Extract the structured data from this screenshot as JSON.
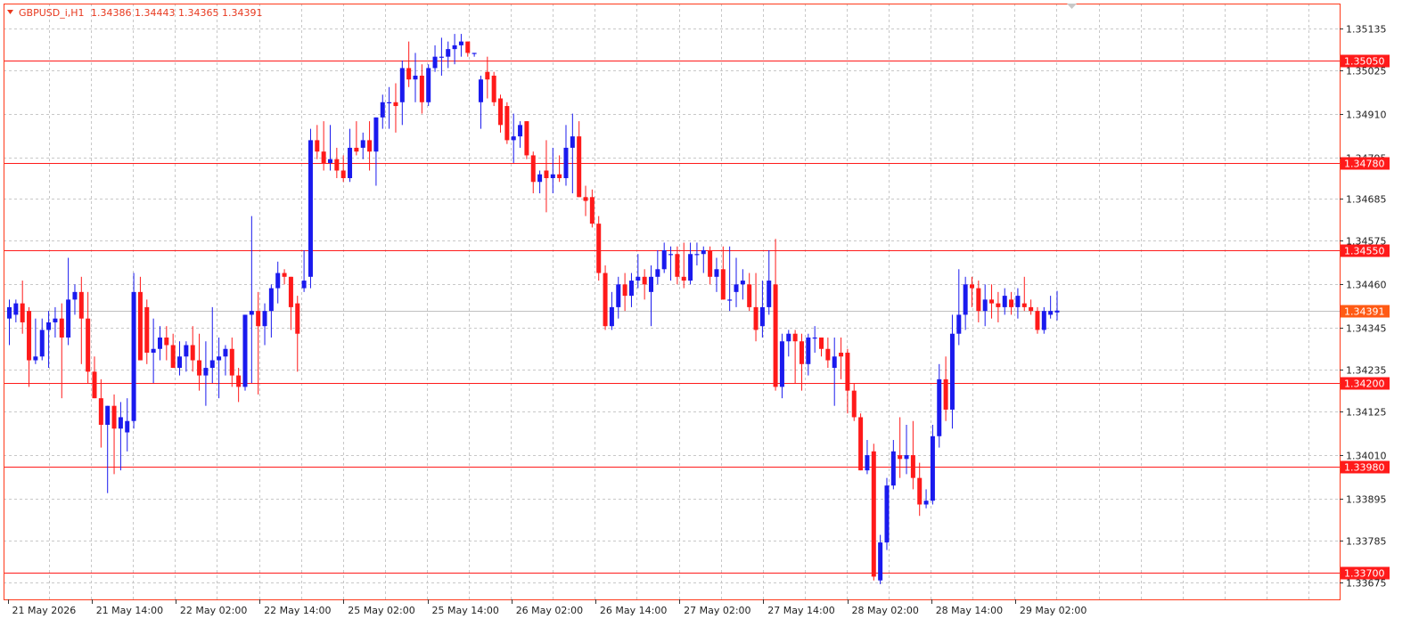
{
  "header": {
    "symbol_label": "GBPUSD_i,H1",
    "ohlc": "1.34386 1.34443 1.34365 1.34391",
    "collapse_icon": "triangle-down-icon"
  },
  "colors": {
    "bull": "#1a1aee",
    "bear": "#ff1a1a",
    "grid": "#c8c8c8",
    "level_line": "#ff1a1a",
    "frame": "#ff3a1a",
    "bid_line": "#c0c0c0",
    "bid_label_bg": "#ff5a14"
  },
  "chart_data": {
    "type": "candlestick",
    "symbol": "GBPUSD_i",
    "timeframe": "H1",
    "ylim": [
      1.3363,
      1.352
    ],
    "y_ticks": [
      "1.35135",
      "1.35025",
      "1.34910",
      "1.34795",
      "1.34685",
      "1.34575",
      "1.34460",
      "1.34345",
      "1.34235",
      "1.34125",
      "1.34010",
      "1.33895",
      "1.33785",
      "1.33675"
    ],
    "x_ticks": [
      "21 May 2026",
      "21 May 14:00",
      "22 May 02:00",
      "22 May 14:00",
      "25 May 02:00",
      "25 May 14:00",
      "26 May 02:00",
      "26 May 14:00",
      "27 May 02:00",
      "27 May 14:00",
      "28 May 02:00",
      "28 May 14:00",
      "29 May 02:00"
    ],
    "levels": [
      "1.35050",
      "1.34780",
      "1.34550",
      "1.34200",
      "1.33980",
      "1.33700"
    ],
    "current_price": "1.34391",
    "grid": true,
    "candles": [
      {
        "o": 1.3437,
        "h": 1.3442,
        "l": 1.343,
        "c": 1.344
      },
      {
        "o": 1.3438,
        "h": 1.3442,
        "l": 1.3436,
        "c": 1.3441
      },
      {
        "o": 1.3441,
        "h": 1.3447,
        "l": 1.3433,
        "c": 1.3436
      },
      {
        "o": 1.3439,
        "h": 1.344,
        "l": 1.3419,
        "c": 1.3426
      },
      {
        "o": 1.3426,
        "h": 1.3437,
        "l": 1.3425,
        "c": 1.3427
      },
      {
        "o": 1.3427,
        "h": 1.3437,
        "l": 1.3426,
        "c": 1.3434
      },
      {
        "o": 1.3434,
        "h": 1.3439,
        "l": 1.3424,
        "c": 1.3436
      },
      {
        "o": 1.3436,
        "h": 1.344,
        "l": 1.3432,
        "c": 1.3437
      },
      {
        "o": 1.3437,
        "h": 1.3441,
        "l": 1.3416,
        "c": 1.3432
      },
      {
        "o": 1.3432,
        "h": 1.3453,
        "l": 1.343,
        "c": 1.3442
      },
      {
        "o": 1.3442,
        "h": 1.3446,
        "l": 1.3438,
        "c": 1.3444
      },
      {
        "o": 1.3444,
        "h": 1.3448,
        "l": 1.3425,
        "c": 1.3437
      },
      {
        "o": 1.3437,
        "h": 1.3444,
        "l": 1.342,
        "c": 1.3423
      },
      {
        "o": 1.3423,
        "h": 1.3427,
        "l": 1.3416,
        "c": 1.3416
      },
      {
        "o": 1.3416,
        "h": 1.3421,
        "l": 1.3403,
        "c": 1.3409
      },
      {
        "o": 1.3409,
        "h": 1.3413,
        "l": 1.3391,
        "c": 1.3414
      },
      {
        "o": 1.3414,
        "h": 1.3417,
        "l": 1.3396,
        "c": 1.3408
      },
      {
        "o": 1.3408,
        "h": 1.3415,
        "l": 1.3397,
        "c": 1.3411
      },
      {
        "o": 1.3407,
        "h": 1.3416,
        "l": 1.3402,
        "c": 1.341
      },
      {
        "o": 1.341,
        "h": 1.3449,
        "l": 1.3408,
        "c": 1.3444
      },
      {
        "o": 1.3444,
        "h": 1.3448,
        "l": 1.3427,
        "c": 1.3426
      },
      {
        "o": 1.344,
        "h": 1.3442,
        "l": 1.3425,
        "c": 1.3428
      },
      {
        "o": 1.3428,
        "h": 1.3437,
        "l": 1.342,
        "c": 1.3429
      },
      {
        "o": 1.3429,
        "h": 1.3435,
        "l": 1.3426,
        "c": 1.3432
      },
      {
        "o": 1.3432,
        "h": 1.3435,
        "l": 1.3426,
        "c": 1.343
      },
      {
        "o": 1.343,
        "h": 1.3433,
        "l": 1.3424,
        "c": 1.3424
      },
      {
        "o": 1.3424,
        "h": 1.3431,
        "l": 1.3422,
        "c": 1.3427
      },
      {
        "o": 1.3427,
        "h": 1.3431,
        "l": 1.3423,
        "c": 1.343
      },
      {
        "o": 1.343,
        "h": 1.3435,
        "l": 1.3423,
        "c": 1.3426
      },
      {
        "o": 1.3426,
        "h": 1.3433,
        "l": 1.3418,
        "c": 1.3422
      },
      {
        "o": 1.3422,
        "h": 1.3431,
        "l": 1.3414,
        "c": 1.3424
      },
      {
        "o": 1.3424,
        "h": 1.344,
        "l": 1.342,
        "c": 1.3426
      },
      {
        "o": 1.3426,
        "h": 1.3432,
        "l": 1.3416,
        "c": 1.3427
      },
      {
        "o": 1.3427,
        "h": 1.343,
        "l": 1.3422,
        "c": 1.3429
      },
      {
        "o": 1.3429,
        "h": 1.3432,
        "l": 1.3419,
        "c": 1.3422
      },
      {
        "o": 1.3422,
        "h": 1.3424,
        "l": 1.3415,
        "c": 1.3419
      },
      {
        "o": 1.3419,
        "h": 1.3438,
        "l": 1.3418,
        "c": 1.3438
      },
      {
        "o": 1.3438,
        "h": 1.3464,
        "l": 1.342,
        "c": 1.3439
      },
      {
        "o": 1.3439,
        "h": 1.3444,
        "l": 1.3417,
        "c": 1.3435
      },
      {
        "o": 1.3435,
        "h": 1.3441,
        "l": 1.343,
        "c": 1.3439
      },
      {
        "o": 1.3439,
        "h": 1.3446,
        "l": 1.3432,
        "c": 1.3445
      },
      {
        "o": 1.3445,
        "h": 1.3452,
        "l": 1.3441,
        "c": 1.3449
      },
      {
        "o": 1.3449,
        "h": 1.345,
        "l": 1.3446,
        "c": 1.3448
      },
      {
        "o": 1.3448,
        "h": 1.3446,
        "l": 1.3434,
        "c": 1.344
      },
      {
        "o": 1.3441,
        "h": 1.3443,
        "l": 1.3423,
        "c": 1.3433
      },
      {
        "o": 1.3445,
        "h": 1.3455,
        "l": 1.3444,
        "c": 1.3447
      },
      {
        "o": 1.3448,
        "h": 1.3487,
        "l": 1.3445,
        "c": 1.3484
      },
      {
        "o": 1.3484,
        "h": 1.3488,
        "l": 1.3479,
        "c": 1.3481
      },
      {
        "o": 1.3481,
        "h": 1.3489,
        "l": 1.3476,
        "c": 1.3478
      },
      {
        "o": 1.3478,
        "h": 1.3488,
        "l": 1.3476,
        "c": 1.3479
      },
      {
        "o": 1.3479,
        "h": 1.3482,
        "l": 1.3474,
        "c": 1.3476
      },
      {
        "o": 1.3476,
        "h": 1.348,
        "l": 1.3473,
        "c": 1.3474
      },
      {
        "o": 1.3474,
        "h": 1.3487,
        "l": 1.3473,
        "c": 1.3482
      },
      {
        "o": 1.3482,
        "h": 1.3489,
        "l": 1.348,
        "c": 1.3481
      },
      {
        "o": 1.3482,
        "h": 1.3486,
        "l": 1.3479,
        "c": 1.3484
      },
      {
        "o": 1.3484,
        "h": 1.3489,
        "l": 1.3476,
        "c": 1.3481
      },
      {
        "o": 1.3481,
        "h": 1.349,
        "l": 1.3472,
        "c": 1.349
      },
      {
        "o": 1.349,
        "h": 1.3496,
        "l": 1.3487,
        "c": 1.3494
      },
      {
        "o": 1.3494,
        "h": 1.3498,
        "l": 1.3487,
        "c": 1.3494
      },
      {
        "o": 1.3494,
        "h": 1.3499,
        "l": 1.3486,
        "c": 1.3493
      },
      {
        "o": 1.3494,
        "h": 1.3505,
        "l": 1.3488,
        "c": 1.3503
      },
      {
        "o": 1.3503,
        "h": 1.351,
        "l": 1.3498,
        "c": 1.35
      },
      {
        "o": 1.35,
        "h": 1.3507,
        "l": 1.3494,
        "c": 1.3501
      },
      {
        "o": 1.3501,
        "h": 1.3504,
        "l": 1.3491,
        "c": 1.3494
      },
      {
        "o": 1.3494,
        "h": 1.3504,
        "l": 1.3493,
        "c": 1.3503
      },
      {
        "o": 1.3503,
        "h": 1.3509,
        "l": 1.3502,
        "c": 1.3506
      },
      {
        "o": 1.3506,
        "h": 1.3511,
        "l": 1.3501,
        "c": 1.3506
      },
      {
        "o": 1.3506,
        "h": 1.351,
        "l": 1.3503,
        "c": 1.3508
      },
      {
        "o": 1.3508,
        "h": 1.3512,
        "l": 1.3504,
        "c": 1.3509
      },
      {
        "o": 1.3509,
        "h": 1.3512,
        "l": 1.3506,
        "c": 1.351
      },
      {
        "o": 1.351,
        "h": 1.3509,
        "l": 1.3506,
        "c": 1.3507
      },
      {
        "o": 1.3507,
        "h": 1.3507,
        "l": 1.3506,
        "c": 1.3507
      },
      {
        "o": 1.3494,
        "h": 1.3501,
        "l": 1.3487,
        "c": 1.35
      },
      {
        "o": 1.3502,
        "h": 1.3506,
        "l": 1.3495,
        "c": 1.35
      },
      {
        "o": 1.3501,
        "h": 1.3502,
        "l": 1.3493,
        "c": 1.3494
      },
      {
        "o": 1.3495,
        "h": 1.3496,
        "l": 1.3486,
        "c": 1.3488
      },
      {
        "o": 1.3493,
        "h": 1.3494,
        "l": 1.3483,
        "c": 1.3484
      },
      {
        "o": 1.3484,
        "h": 1.3491,
        "l": 1.3478,
        "c": 1.3485
      },
      {
        "o": 1.3485,
        "h": 1.3489,
        "l": 1.3482,
        "c": 1.3488
      },
      {
        "o": 1.3489,
        "h": 1.3488,
        "l": 1.3479,
        "c": 1.348
      },
      {
        "o": 1.348,
        "h": 1.3481,
        "l": 1.347,
        "c": 1.3473
      },
      {
        "o": 1.3473,
        "h": 1.3476,
        "l": 1.347,
        "c": 1.3475
      },
      {
        "o": 1.3476,
        "h": 1.3484,
        "l": 1.3465,
        "c": 1.3474
      },
      {
        "o": 1.3474,
        "h": 1.3482,
        "l": 1.347,
        "c": 1.3475
      },
      {
        "o": 1.3475,
        "h": 1.348,
        "l": 1.3473,
        "c": 1.3474
      },
      {
        "o": 1.3474,
        "h": 1.3488,
        "l": 1.3472,
        "c": 1.3482
      },
      {
        "o": 1.3482,
        "h": 1.3491,
        "l": 1.347,
        "c": 1.3485
      },
      {
        "o": 1.3485,
        "h": 1.3489,
        "l": 1.3472,
        "c": 1.3469
      },
      {
        "o": 1.3469,
        "h": 1.3472,
        "l": 1.3464,
        "c": 1.3468
      },
      {
        "o": 1.3469,
        "h": 1.3471,
        "l": 1.3461,
        "c": 1.3462
      },
      {
        "o": 1.3462,
        "h": 1.3464,
        "l": 1.3447,
        "c": 1.3449
      },
      {
        "o": 1.3449,
        "h": 1.3451,
        "l": 1.3434,
        "c": 1.3435
      },
      {
        "o": 1.3435,
        "h": 1.3444,
        "l": 1.3434,
        "c": 1.344
      },
      {
        "o": 1.344,
        "h": 1.3448,
        "l": 1.3437,
        "c": 1.3446
      },
      {
        "o": 1.3446,
        "h": 1.3449,
        "l": 1.3439,
        "c": 1.3443
      },
      {
        "o": 1.3443,
        "h": 1.3449,
        "l": 1.344,
        "c": 1.3447
      },
      {
        "o": 1.3447,
        "h": 1.3454,
        "l": 1.3445,
        "c": 1.3448
      },
      {
        "o": 1.3448,
        "h": 1.345,
        "l": 1.3442,
        "c": 1.3446
      },
      {
        "o": 1.3444,
        "h": 1.3451,
        "l": 1.3435,
        "c": 1.3448
      },
      {
        "o": 1.3448,
        "h": 1.3455,
        "l": 1.3446,
        "c": 1.345
      },
      {
        "o": 1.345,
        "h": 1.3457,
        "l": 1.3449,
        "c": 1.3455
      },
      {
        "o": 1.3454,
        "h": 1.3456,
        "l": 1.3447,
        "c": 1.3454
      },
      {
        "o": 1.3454,
        "h": 1.3456,
        "l": 1.3446,
        "c": 1.3448
      },
      {
        "o": 1.3448,
        "h": 1.3457,
        "l": 1.3445,
        "c": 1.3447
      },
      {
        "o": 1.3447,
        "h": 1.3457,
        "l": 1.3446,
        "c": 1.3454
      },
      {
        "o": 1.3454,
        "h": 1.3457,
        "l": 1.3451,
        "c": 1.3454
      },
      {
        "o": 1.3454,
        "h": 1.3456,
        "l": 1.3449,
        "c": 1.3455
      },
      {
        "o": 1.3455,
        "h": 1.3456,
        "l": 1.3446,
        "c": 1.3448
      },
      {
        "o": 1.3448,
        "h": 1.3453,
        "l": 1.3444,
        "c": 1.345
      },
      {
        "o": 1.345,
        "h": 1.3456,
        "l": 1.3443,
        "c": 1.3442
      },
      {
        "o": 1.3442,
        "h": 1.3456,
        "l": 1.3439,
        "c": 1.3442
      },
      {
        "o": 1.3444,
        "h": 1.3453,
        "l": 1.344,
        "c": 1.3446
      },
      {
        "o": 1.3446,
        "h": 1.345,
        "l": 1.3442,
        "c": 1.3447
      },
      {
        "o": 1.3446,
        "h": 1.3449,
        "l": 1.3439,
        "c": 1.344
      },
      {
        "o": 1.344,
        "h": 1.3449,
        "l": 1.3431,
        "c": 1.3434
      },
      {
        "o": 1.3435,
        "h": 1.3447,
        "l": 1.3432,
        "c": 1.344
      },
      {
        "o": 1.344,
        "h": 1.3455,
        "l": 1.3438,
        "c": 1.3447
      },
      {
        "o": 1.3446,
        "h": 1.3458,
        "l": 1.3418,
        "c": 1.3419
      },
      {
        "o": 1.3419,
        "h": 1.3433,
        "l": 1.3416,
        "c": 1.3431
      },
      {
        "o": 1.3431,
        "h": 1.3434,
        "l": 1.3427,
        "c": 1.3433
      },
      {
        "o": 1.3433,
        "h": 1.3434,
        "l": 1.342,
        "c": 1.3431
      },
      {
        "o": 1.3431,
        "h": 1.3433,
        "l": 1.3418,
        "c": 1.3425
      },
      {
        "o": 1.3425,
        "h": 1.3433,
        "l": 1.3422,
        "c": 1.3432
      },
      {
        "o": 1.3432,
        "h": 1.3435,
        "l": 1.3428,
        "c": 1.3432
      },
      {
        "o": 1.3432,
        "h": 1.3432,
        "l": 1.3427,
        "c": 1.3429
      },
      {
        "o": 1.3429,
        "h": 1.3432,
        "l": 1.3424,
        "c": 1.3426
      },
      {
        "o": 1.3424,
        "h": 1.3432,
        "l": 1.3414,
        "c": 1.3427
      },
      {
        "o": 1.3428,
        "h": 1.3432,
        "l": 1.3421,
        "c": 1.3427
      },
      {
        "o": 1.3428,
        "h": 1.3429,
        "l": 1.3412,
        "c": 1.3418
      },
      {
        "o": 1.3418,
        "h": 1.342,
        "l": 1.341,
        "c": 1.3411
      },
      {
        "o": 1.3411,
        "h": 1.3412,
        "l": 1.3397,
        "c": 1.3397
      },
      {
        "o": 1.3397,
        "h": 1.3405,
        "l": 1.3396,
        "c": 1.3401
      },
      {
        "o": 1.3402,
        "h": 1.3404,
        "l": 1.3368,
        "c": 1.3369
      },
      {
        "o": 1.3368,
        "h": 1.338,
        "l": 1.3367,
        "c": 1.3378
      },
      {
        "o": 1.3378,
        "h": 1.3395,
        "l": 1.3376,
        "c": 1.3393
      },
      {
        "o": 1.3393,
        "h": 1.3405,
        "l": 1.3392,
        "c": 1.3402
      },
      {
        "o": 1.3401,
        "h": 1.3411,
        "l": 1.3395,
        "c": 1.34
      },
      {
        "o": 1.34,
        "h": 1.3409,
        "l": 1.3396,
        "c": 1.3401
      },
      {
        "o": 1.3401,
        "h": 1.341,
        "l": 1.3392,
        "c": 1.3395
      },
      {
        "o": 1.3395,
        "h": 1.3399,
        "l": 1.3385,
        "c": 1.3388
      },
      {
        "o": 1.3388,
        "h": 1.3392,
        "l": 1.3387,
        "c": 1.3389
      },
      {
        "o": 1.3389,
        "h": 1.3409,
        "l": 1.3388,
        "c": 1.3406
      },
      {
        "o": 1.3406,
        "h": 1.3425,
        "l": 1.3403,
        "c": 1.3421
      },
      {
        "o": 1.3421,
        "h": 1.3427,
        "l": 1.341,
        "c": 1.3413
      },
      {
        "o": 1.3413,
        "h": 1.3438,
        "l": 1.3408,
        "c": 1.3433
      },
      {
        "o": 1.3433,
        "h": 1.345,
        "l": 1.343,
        "c": 1.3438
      },
      {
        "o": 1.3438,
        "h": 1.3448,
        "l": 1.3434,
        "c": 1.3446
      },
      {
        "o": 1.3446,
        "h": 1.3448,
        "l": 1.344,
        "c": 1.3445
      },
      {
        "o": 1.3445,
        "h": 1.3447,
        "l": 1.3436,
        "c": 1.3439
      },
      {
        "o": 1.3439,
        "h": 1.3446,
        "l": 1.3435,
        "c": 1.3442
      },
      {
        "o": 1.3442,
        "h": 1.3446,
        "l": 1.3437,
        "c": 1.3441
      },
      {
        "o": 1.3441,
        "h": 1.3444,
        "l": 1.3436,
        "c": 1.344
      },
      {
        "o": 1.344,
        "h": 1.3445,
        "l": 1.3438,
        "c": 1.3443
      },
      {
        "o": 1.3442,
        "h": 1.3444,
        "l": 1.3438,
        "c": 1.344
      },
      {
        "o": 1.344,
        "h": 1.3445,
        "l": 1.3437,
        "c": 1.3443
      },
      {
        "o": 1.3441,
        "h": 1.3448,
        "l": 1.3439,
        "c": 1.344
      },
      {
        "o": 1.344,
        "h": 1.3442,
        "l": 1.3438,
        "c": 1.3439
      },
      {
        "o": 1.3439,
        "h": 1.344,
        "l": 1.3433,
        "c": 1.3434
      },
      {
        "o": 1.3434,
        "h": 1.344,
        "l": 1.3433,
        "c": 1.3439
      },
      {
        "o": 1.3438,
        "h": 1.3443,
        "l": 1.3437,
        "c": 1.3439
      },
      {
        "o": 1.34386,
        "h": 1.34443,
        "l": 1.34365,
        "c": 1.34391
      }
    ]
  }
}
